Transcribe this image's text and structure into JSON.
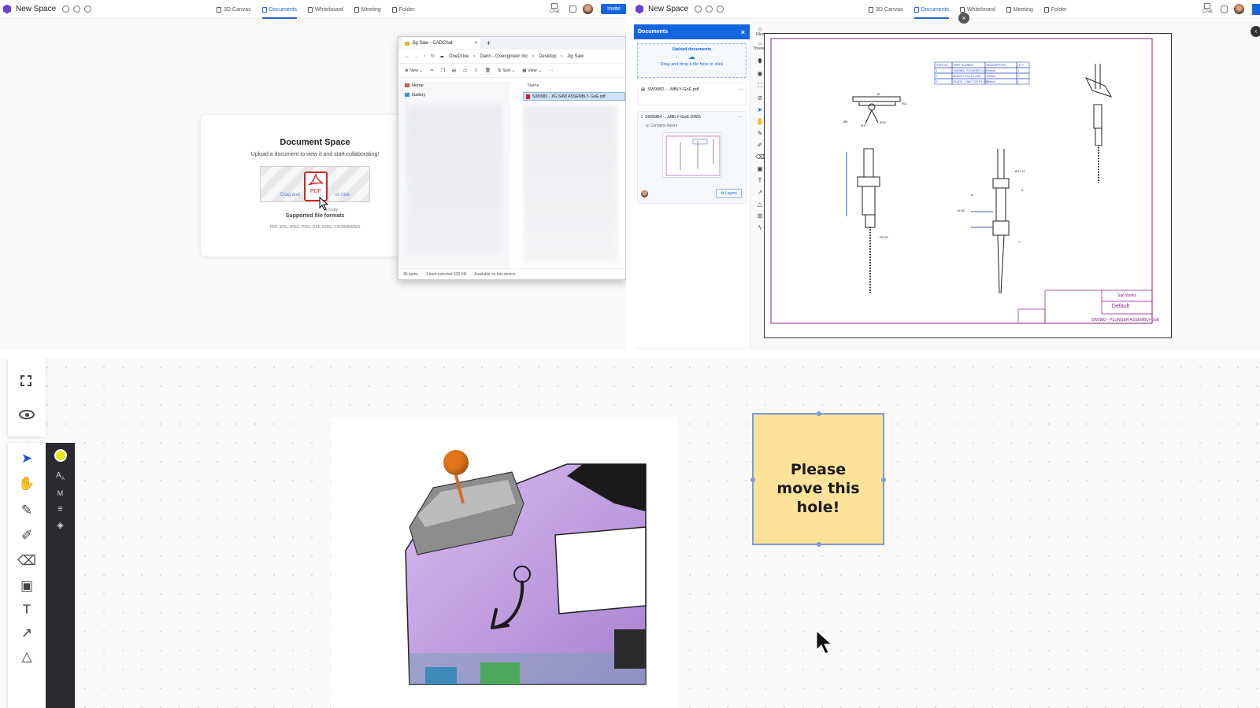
{
  "app": {
    "space_name": "New Space"
  },
  "tabs": [
    "3D Canvas",
    "Documents",
    "Whiteboard",
    "Meeting",
    "Folder"
  ],
  "top_right": {
    "chat_label": "Chat",
    "invite_label": "Invite"
  },
  "doc_space": {
    "title": "Document Space",
    "subtitle": "Upload a document to view it and start collaborating!",
    "drop_left": "Drag and",
    "drop_right": "or click",
    "pdf_label": "PDF",
    "copy_label": "+ Copy",
    "formats_title": "Supported file formats",
    "formats_list": "PDF, JPG, JPEG, PNG, DXF, DWG, CATDRAWING"
  },
  "explorer": {
    "tab_title": "Jig Saw - CADChat",
    "breadcrumb": [
      "OneDrive",
      "Darin - Goengineer Inc",
      "Desktop",
      "Jig Saw"
    ],
    "toolbar_new": "New",
    "toolbar_sort": "Sort",
    "toolbar_view": "View",
    "nav": [
      "Home",
      "Gallery"
    ],
    "col_name": "Name",
    "selected_file": "SW9982 - JIG SAW ASSEMBLY- GoE.pdf",
    "status": [
      "36 items",
      "1 item selected  320 KB",
      "Available on this device"
    ]
  },
  "docs_panel": {
    "header": "Documents",
    "upload_title": "Upload documents",
    "upload_hint": "Drag and drop a file here or click",
    "files": [
      {
        "name": "SW9982 -...MBLY-GoE.pdf"
      },
      {
        "name": "SW9984 -...MBLY-GoE.DWG",
        "sub": "Contains layers",
        "layers_btn": "Layers"
      }
    ]
  },
  "side_icons": {
    "files": "Files",
    "threads": "Threads"
  },
  "drawing": {
    "bom_headers": [
      "ITEM NO.",
      "PART NUMBER",
      "DESCRIPTION",
      "QTY."
    ],
    "bom_rows": [
      [
        "1",
        "SW9983 - PLUNGER-GoE",
        "Default",
        "1"
      ],
      [
        "2",
        "BLADE COLLET-GoE",
        "Default",
        "1"
      ],
      [
        "3",
        "BLADE - FINE TOOTH-GoE",
        "Default",
        "1"
      ]
    ],
    "dims": [
      "16",
      "R11",
      "Ø8",
      "Ø15",
      "Ø17",
      "R0.50",
      "Ø11.11",
      "16.50",
      "8",
      "9",
      "7"
    ],
    "title_company": "Sao Works",
    "title_config": "Default",
    "title_name": "SW9983 - PLUNGER ASSEMBLY-GoE"
  },
  "whiteboard": {
    "sticky_text": "Please move this hole!",
    "pin_color": "#e2741b",
    "sticky_color": "#fde39a",
    "model_color": "#c9a6e6"
  },
  "colors": {
    "accent": "#2563c9",
    "brand": "#6b3fd6",
    "drawing_line": "#8a1a8a"
  }
}
